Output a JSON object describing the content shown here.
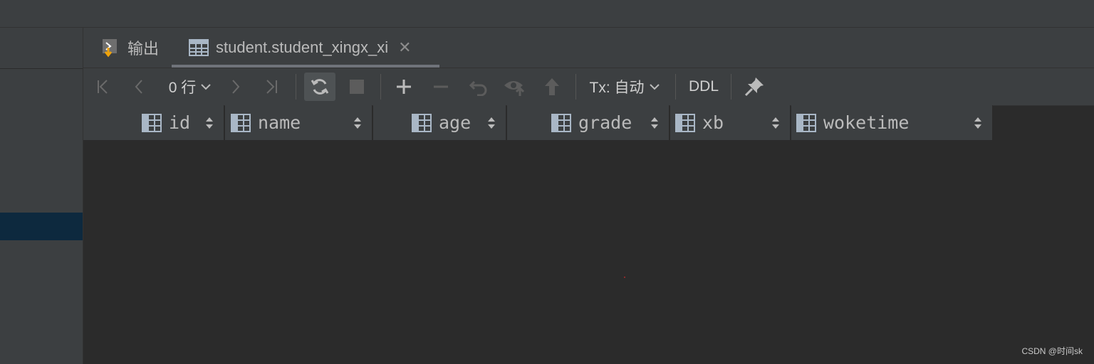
{
  "tabs": [
    {
      "label": "输出",
      "icon": "output-icon"
    },
    {
      "label": "student.student_xingx_xi",
      "icon": "table-icon"
    }
  ],
  "toolbar": {
    "rows_label": "0 行",
    "tx_label": "Tx: 自动",
    "ddl_label": "DDL"
  },
  "columns": [
    {
      "name": "id"
    },
    {
      "name": "name"
    },
    {
      "name": "age"
    },
    {
      "name": "grade"
    },
    {
      "name": "xb"
    },
    {
      "name": "woketime"
    }
  ],
  "watermark": "CSDN @时间sk",
  "colors": {
    "background": "#2b2b2b",
    "panel": "#3c3f41",
    "selection": "#0d293e"
  }
}
